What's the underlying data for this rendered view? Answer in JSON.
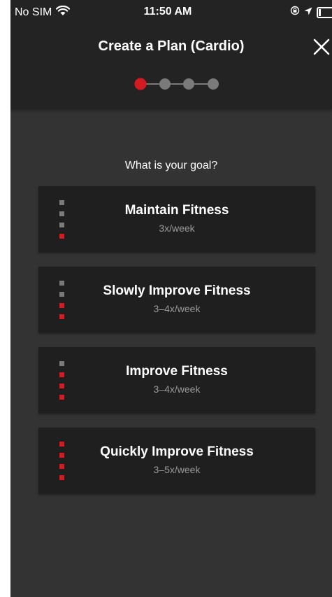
{
  "status_bar": {
    "carrier": "No SIM",
    "time": "11:50 AM"
  },
  "header": {
    "title": "Create a Plan (Cardio)",
    "steps_total": 4,
    "current_step": 1
  },
  "main": {
    "question": "What is your goal?",
    "goals": [
      {
        "title": "Maintain Fitness",
        "frequency": "3x/week",
        "level": 1
      },
      {
        "title": "Slowly Improve Fitness",
        "frequency": "3–4x/week",
        "level": 2
      },
      {
        "title": "Improve Fitness",
        "frequency": "3–4x/week",
        "level": 3
      },
      {
        "title": "Quickly Improve Fitness",
        "frequency": "3–5x/week",
        "level": 4
      }
    ]
  },
  "colors": {
    "accent": "#d61a22",
    "inactive": "#7a7a7a",
    "header_bg": "#232323",
    "page_bg": "#333333",
    "card_bg": "#1f1f1f"
  },
  "icons": {
    "wifi": "wifi-icon",
    "location": "location-arrow-icon",
    "lock": "orientation-lock-icon",
    "battery": "battery-icon",
    "close": "close-icon"
  }
}
